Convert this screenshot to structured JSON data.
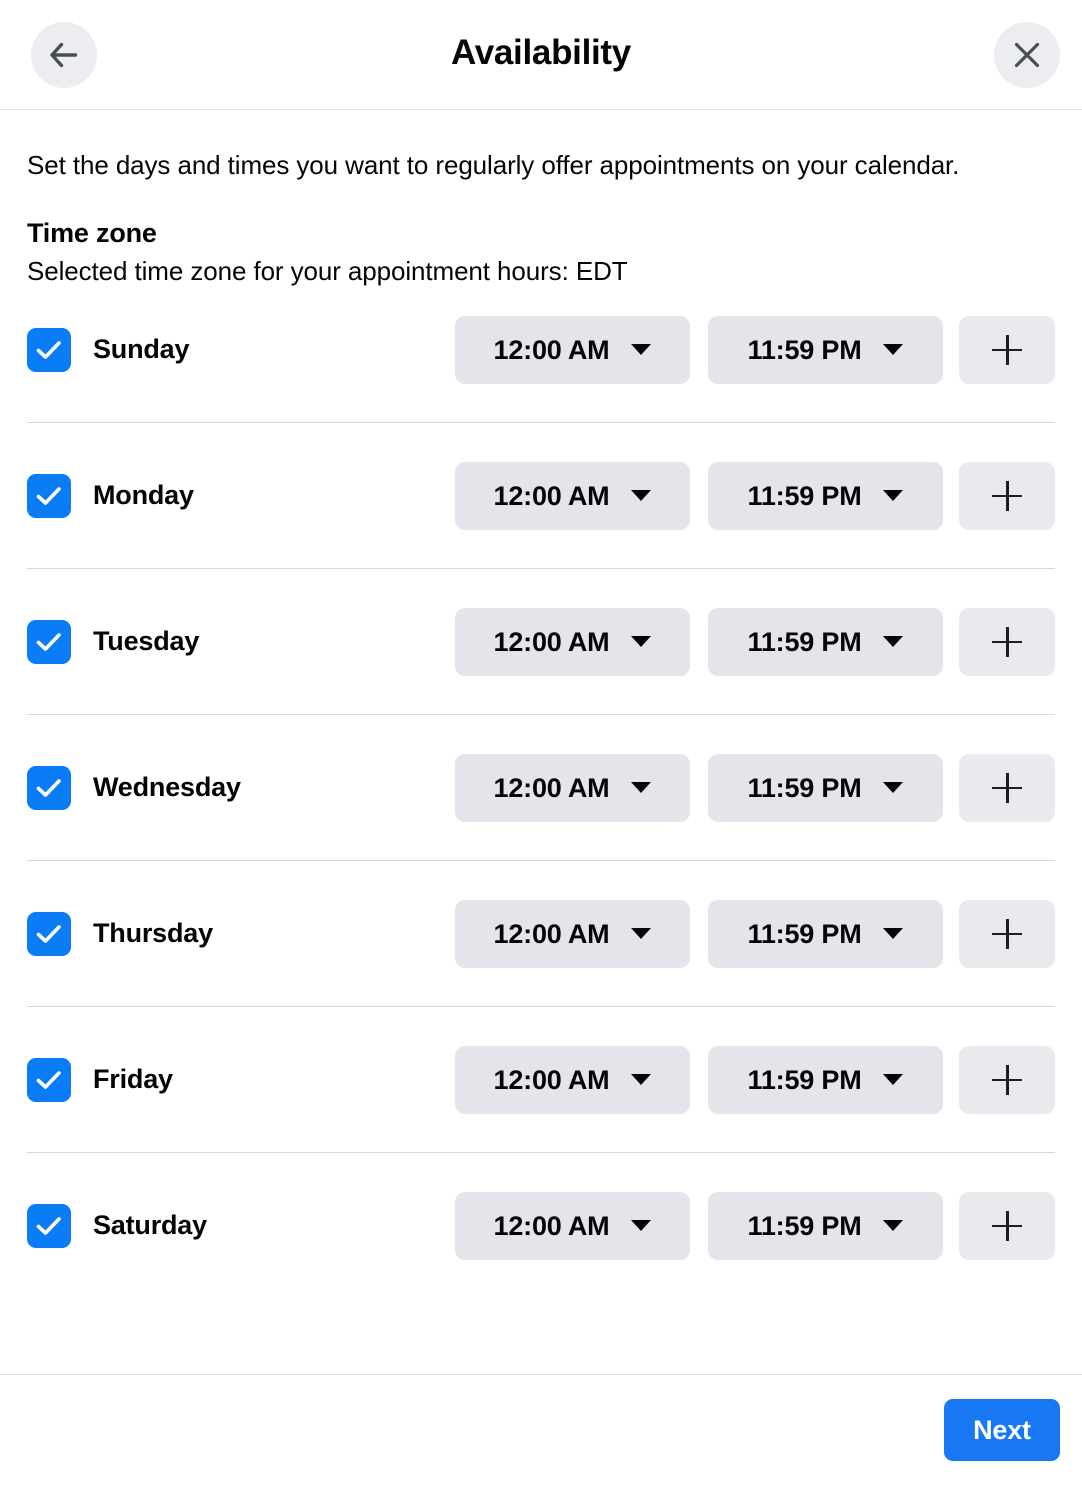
{
  "header": {
    "title": "Availability",
    "back_icon": "arrow-left-icon",
    "close_icon": "close-icon"
  },
  "intro": {
    "description": "Set the days and times you want to regularly offer appointments on your calendar."
  },
  "time_zone": {
    "heading": "Time zone",
    "description": "Selected time zone for your appointment hours: EDT",
    "value": "EDT"
  },
  "days": [
    {
      "label": "Sunday",
      "checked": true,
      "start_time": "12:00 AM",
      "end_time": "11:59 PM",
      "add_label": "+"
    },
    {
      "label": "Monday",
      "checked": true,
      "start_time": "12:00 AM",
      "end_time": "11:59 PM",
      "add_label": "+"
    },
    {
      "label": "Tuesday",
      "checked": true,
      "start_time": "12:00 AM",
      "end_time": "11:59 PM",
      "add_label": "+"
    },
    {
      "label": "Wednesday",
      "checked": true,
      "start_time": "12:00 AM",
      "end_time": "11:59 PM",
      "add_label": "+"
    },
    {
      "label": "Thursday",
      "checked": true,
      "start_time": "12:00 AM",
      "end_time": "11:59 PM",
      "add_label": "+"
    },
    {
      "label": "Friday",
      "checked": true,
      "start_time": "12:00 AM",
      "end_time": "11:59 PM",
      "add_label": "+"
    },
    {
      "label": "Saturday",
      "checked": true,
      "start_time": "12:00 AM",
      "end_time": "11:59 PM",
      "add_label": "+"
    }
  ],
  "footer": {
    "next_label": "Next"
  },
  "colors": {
    "accent_blue": "#1877f2",
    "checkbox_blue": "#0a7cf5",
    "pill_grey": "#e3e5ea",
    "icon_btn_grey": "#ebedf0",
    "divider": "#d5d8dd",
    "text": "#050505"
  }
}
